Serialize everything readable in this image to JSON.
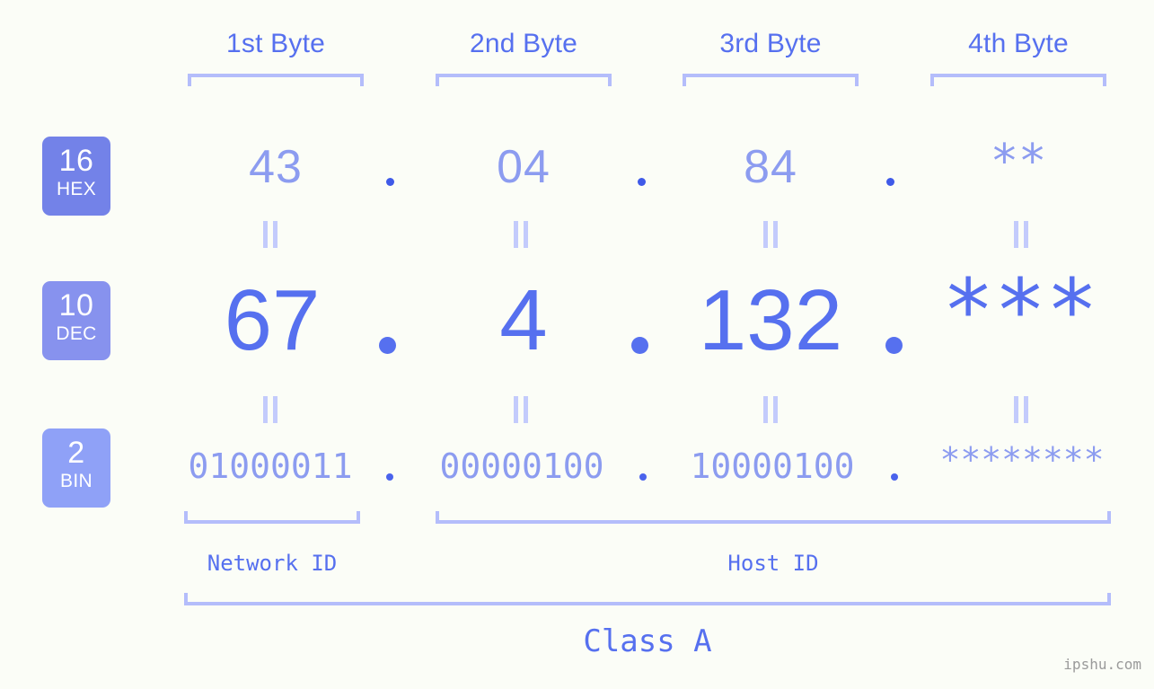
{
  "page": {
    "background": "#fbfdf7",
    "accent_dark": "#5670ef",
    "accent_light": "#8c9cf0",
    "bracket_color": "#b4bdfb",
    "watermark": "ipshu.com"
  },
  "byte_headers": [
    {
      "label": "1st Byte"
    },
    {
      "label": "2nd Byte"
    },
    {
      "label": "3rd Byte"
    },
    {
      "label": "4th Byte"
    }
  ],
  "bases": [
    {
      "num": "16",
      "name": "HEX",
      "color": "#7382e8"
    },
    {
      "num": "10",
      "name": "DEC",
      "color": "#8792ee"
    },
    {
      "num": "2",
      "name": "BIN",
      "color": "#8fa1f7"
    }
  ],
  "rows": {
    "hex": {
      "values": [
        "43",
        "04",
        "84",
        "**"
      ],
      "separator": "."
    },
    "dec": {
      "values": [
        "67",
        "4",
        "132",
        "***"
      ],
      "separator": "."
    },
    "bin": {
      "values": [
        "01000011",
        "00000100",
        "10000100",
        "********"
      ],
      "separator": "."
    }
  },
  "equals_marks": {
    "symbol": "||",
    "count_per_row": 4
  },
  "id_labels": {
    "network": "Network ID",
    "host": "Host ID"
  },
  "class_label": "Class A"
}
